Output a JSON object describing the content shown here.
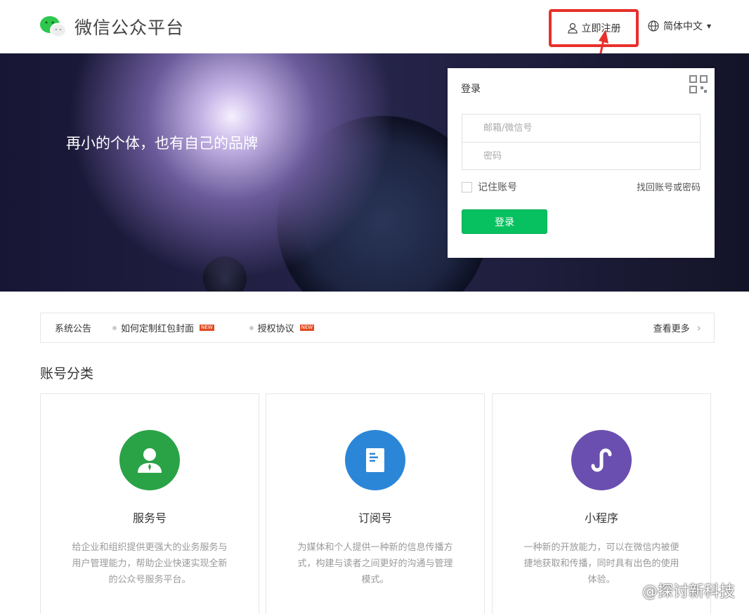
{
  "header": {
    "title": "微信公众平台",
    "register": "立即注册",
    "language": "简体中文"
  },
  "banner": {
    "slogan": "再小的个体，也有自己的品牌"
  },
  "login": {
    "title": "登录",
    "account_placeholder": "邮箱/微信号",
    "password_placeholder": "密码",
    "remember": "记住账号",
    "forgot": "找回账号或密码",
    "submit": "登录"
  },
  "notice": {
    "label": "系统公告",
    "items": [
      {
        "text": "如何定制红包封面",
        "badge": "NEW"
      },
      {
        "text": "授权协议",
        "badge": "NEW"
      }
    ],
    "more": "查看更多"
  },
  "section_title": "账号分类",
  "cards": [
    {
      "title": "服务号",
      "desc": "给企业和组织提供更强大的业务服务与用户管理能力，帮助企业快速实现全新的公众号服务平台。",
      "color": "#2aa346"
    },
    {
      "title": "订阅号",
      "desc": "为媒体和个人提供一种新的信息传播方式，构建与读者之间更好的沟通与管理模式。",
      "color": "#2b86d8"
    },
    {
      "title": "小程序",
      "desc": "一种新的开放能力，可以在微信内被便捷地获取和传播，同时具有出色的使用体验。",
      "color": "#6a4fb0"
    }
  ],
  "watermark": "@探讨新科技"
}
